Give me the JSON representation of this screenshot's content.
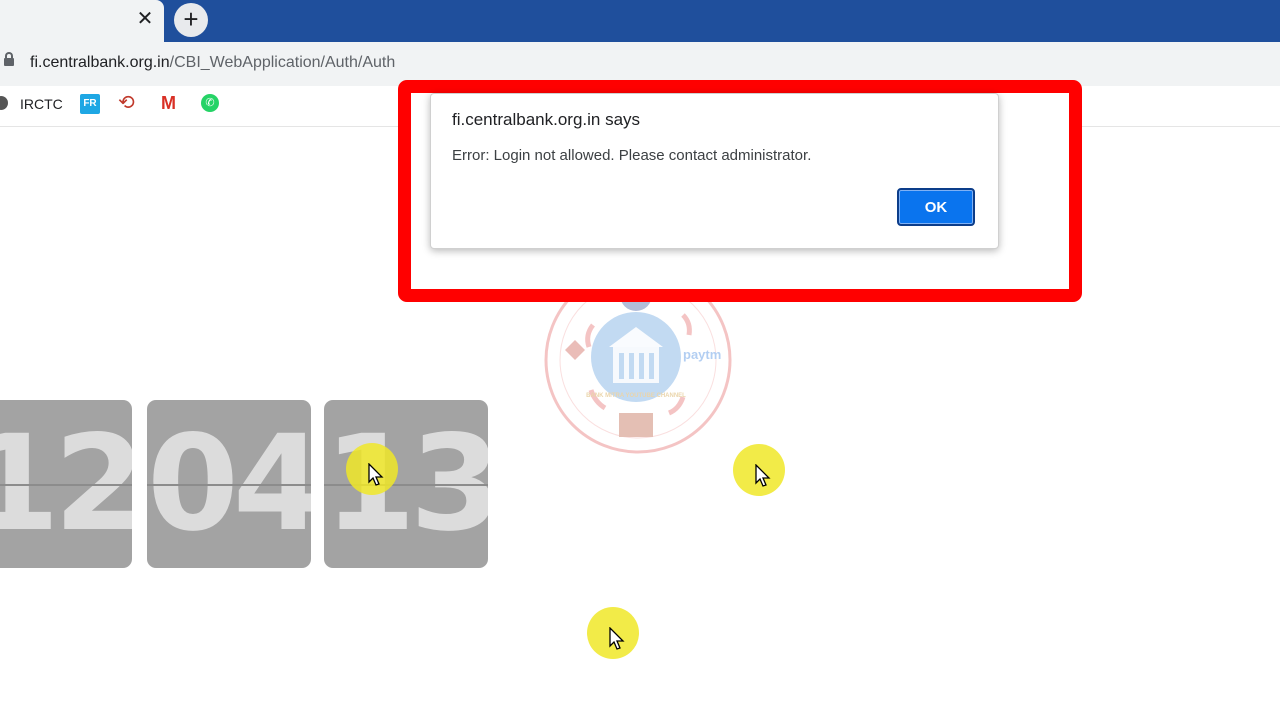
{
  "browser": {
    "tab_close": "✕",
    "new_tab": "+",
    "address": {
      "host": "fi.centralbank.org.in",
      "path": "/CBI_WebApplication/Auth/Auth"
    },
    "bookmarks": [
      {
        "label": "IRCTC",
        "icon": "irctc-icon"
      },
      {
        "label": "",
        "icon": "fr-icon"
      },
      {
        "label": "",
        "icon": "sync-icon"
      },
      {
        "label": "",
        "icon": "gmail-icon"
      },
      {
        "label": "",
        "icon": "whatsapp-icon"
      }
    ]
  },
  "bookmark_glyphs": {
    "fr": "FR",
    "gmail": "M",
    "whatsapp": "✆",
    "sync": "⟲"
  },
  "clock": {
    "hours": "12",
    "minutes": "04",
    "seconds": "13"
  },
  "dialog": {
    "title": "fi.centralbank.org.in says",
    "message": "Error: Login not allowed. Please contact administrator.",
    "ok_label": "OK"
  },
  "watermark": {
    "side_text": "paytm",
    "caption": "BANK MITRA YOUTUBE CHANNEL"
  },
  "colors": {
    "tabstrip": "#1f4f9c",
    "highlight_frame": "#ff0000",
    "ok_button": "#0a74ee",
    "flip_card": "#a3a3a3"
  }
}
